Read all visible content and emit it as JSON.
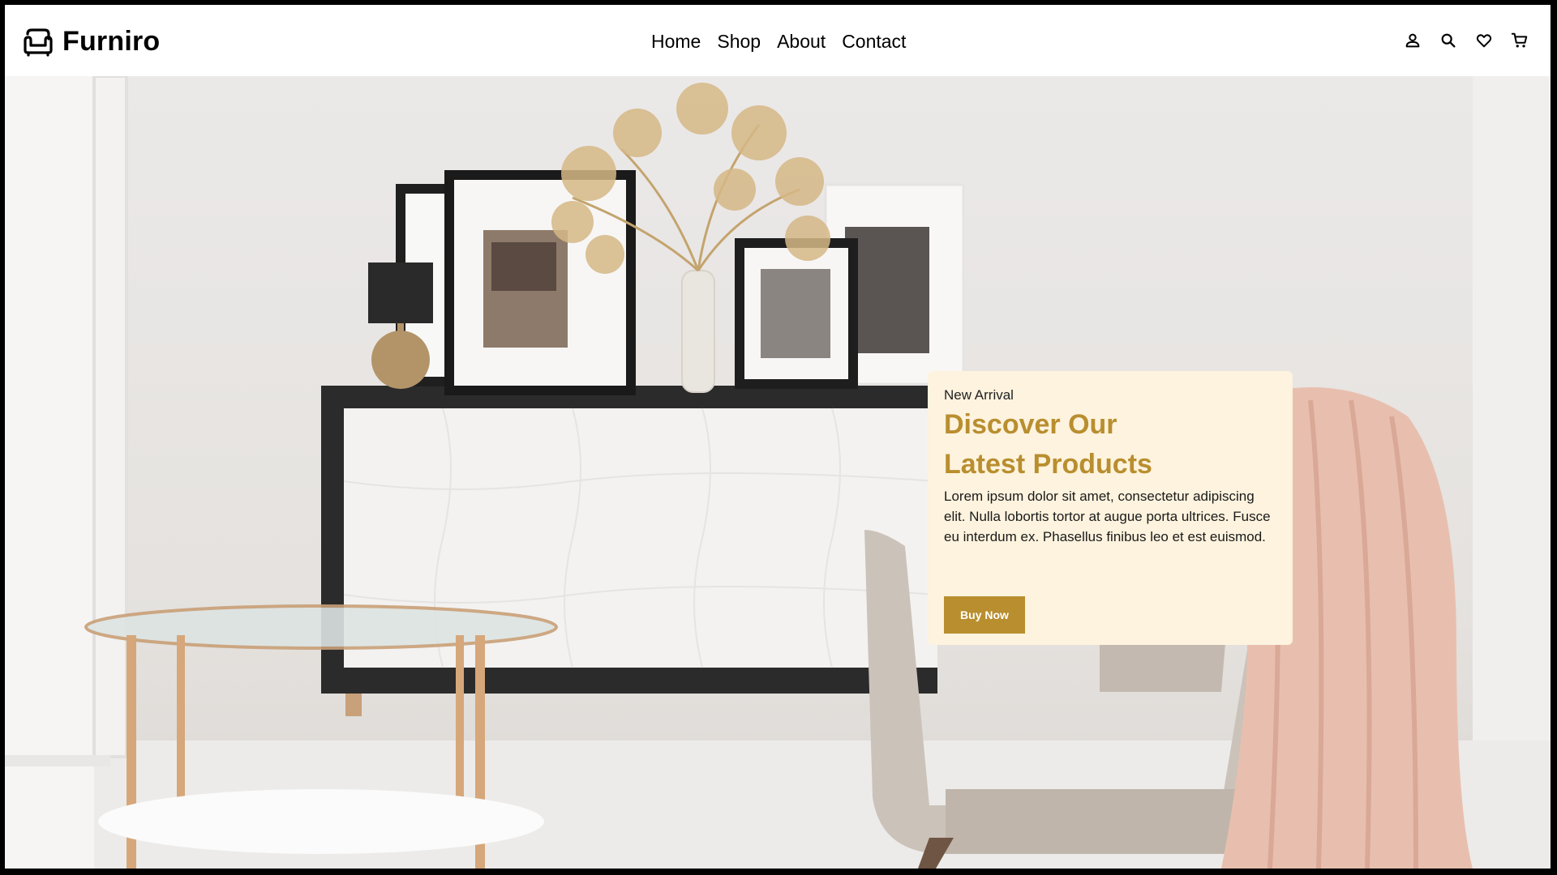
{
  "header": {
    "logo_icon": "sofa-icon",
    "brand": "Furniro",
    "nav": [
      {
        "label": "Home"
      },
      {
        "label": "Shop"
      },
      {
        "label": "About"
      },
      {
        "label": "Contact"
      }
    ],
    "icons": [
      "user-icon",
      "search-icon",
      "heart-icon",
      "cart-icon"
    ]
  },
  "hero": {
    "eyebrow": "New Arrival",
    "title_line1": "Discover Our",
    "title_line2": "Latest Products",
    "body": "Lorem ipsum dolor sit amet, consectetur adipiscing elit. Nulla lobortis tortor at augue porta ultrices. Fusce eu interdum ex. Phasellus finibus leo et est euismod.",
    "button_label": "Buy Now"
  },
  "colors": {
    "accent": "#B88E2F",
    "card_bg": "#FDF3DE",
    "text": "#000000"
  }
}
